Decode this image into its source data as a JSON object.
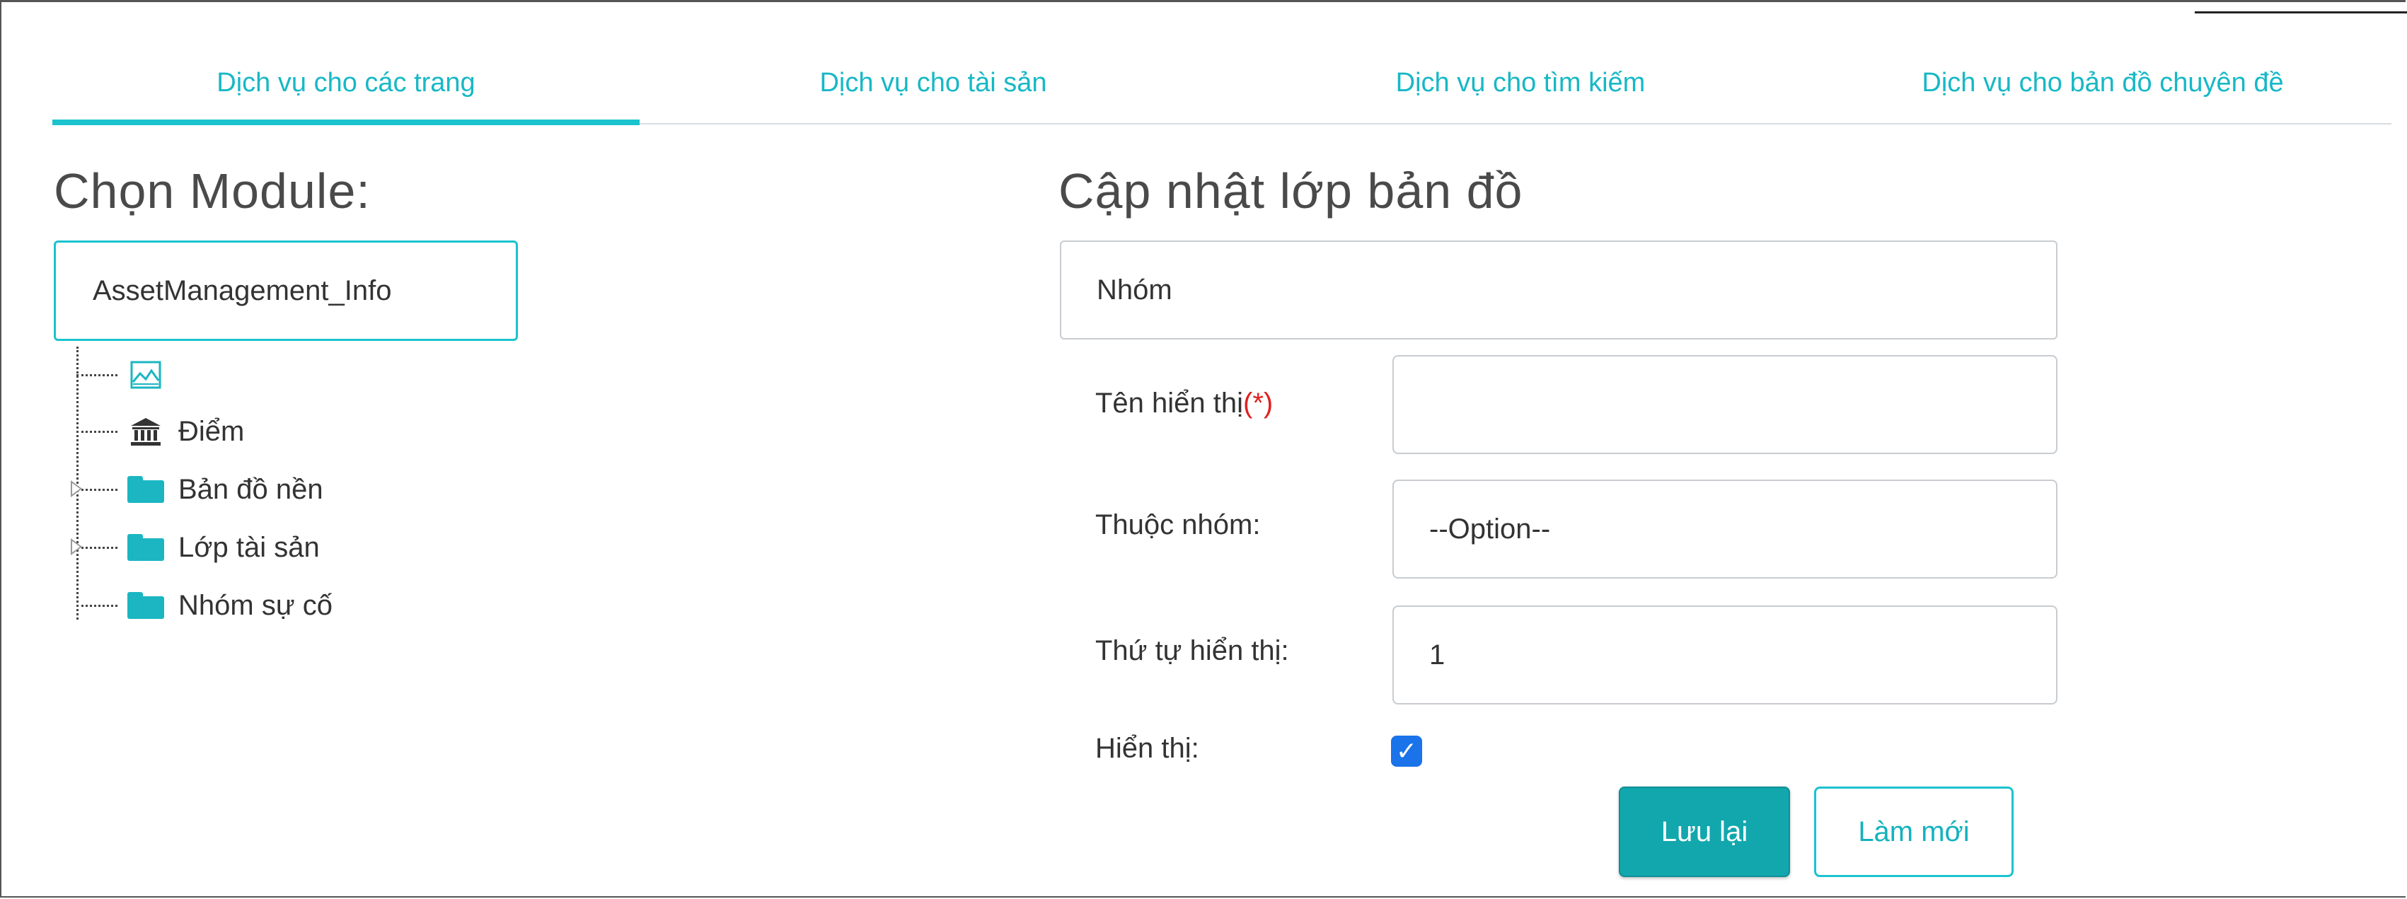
{
  "tabs": [
    {
      "label": "Dịch vụ cho các trang",
      "active": true
    },
    {
      "label": "Dịch vụ cho tài sản",
      "active": false
    },
    {
      "label": "Dịch vụ cho tìm kiếm",
      "active": false
    },
    {
      "label": "Dịch vụ cho bản đồ chuyên đề",
      "active": false
    }
  ],
  "left": {
    "title": "Chọn Module:",
    "module_value": "AssetManagement_Info",
    "tree": [
      {
        "label": "",
        "icon": "map-image-icon",
        "expandable": false
      },
      {
        "label": "Điểm",
        "icon": "bank-building-icon",
        "expandable": false
      },
      {
        "label": "Bản đồ nền",
        "icon": "folder-icon",
        "expandable": true
      },
      {
        "label": "Lớp tài sản",
        "icon": "folder-icon",
        "expandable": true
      },
      {
        "label": "Nhóm sự cố",
        "icon": "folder-icon",
        "expandable": false
      }
    ]
  },
  "right": {
    "title": "Cập nhật lớp bản đồ",
    "group_value": "Nhóm",
    "display_name": {
      "label": "Tên hiển thị",
      "required_mark": "(*)",
      "value": ""
    },
    "parent_group": {
      "label": "Thuộc nhóm:",
      "value": "--Option--"
    },
    "display_order": {
      "label": "Thứ tự hiển thị:",
      "value": "1"
    },
    "visible": {
      "label": "Hiển thị:",
      "checked": true
    },
    "buttons": {
      "save": "Lưu lại",
      "reset": "Làm mới"
    }
  },
  "colors": {
    "accent": "#1bc3cf",
    "save_button": "#12a7ad",
    "checkbox": "#1a73e8",
    "required": "#e02020"
  }
}
